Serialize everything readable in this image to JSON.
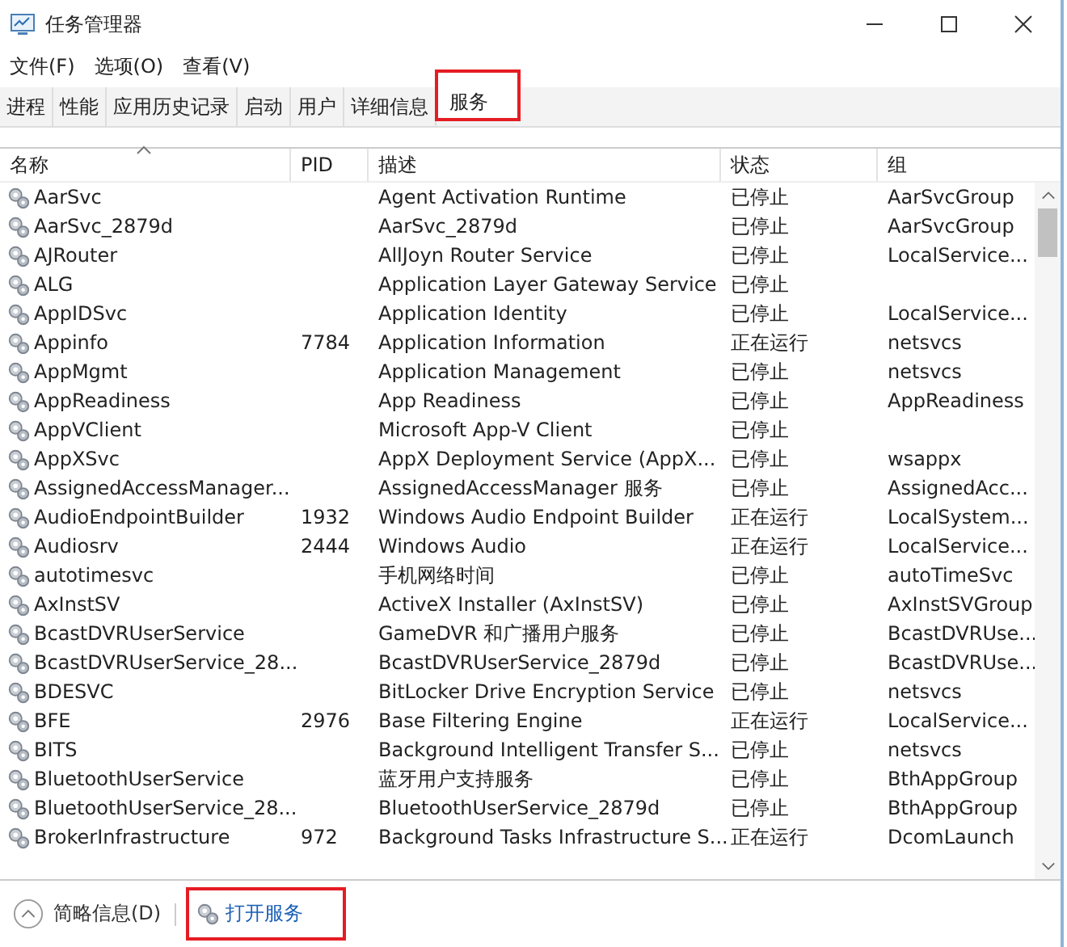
{
  "window": {
    "title": "任务管理器"
  },
  "menu": [
    "文件(F)",
    "选项(O)",
    "查看(V)"
  ],
  "tabs": [
    {
      "label": "进程",
      "selected": false,
      "highlighted": false
    },
    {
      "label": "性能",
      "selected": false,
      "highlighted": false
    },
    {
      "label": "应用历史记录",
      "selected": false,
      "highlighted": false
    },
    {
      "label": "启动",
      "selected": false,
      "highlighted": false
    },
    {
      "label": "用户",
      "selected": false,
      "highlighted": false
    },
    {
      "label": "详细信息",
      "selected": false,
      "highlighted": false
    },
    {
      "label": "服务",
      "selected": true,
      "highlighted": true
    }
  ],
  "table": {
    "columns": [
      "名称",
      "PID",
      "描述",
      "状态",
      "组"
    ],
    "rows": [
      [
        "AarSvc",
        "",
        "Agent Activation Runtime",
        "已停止",
        "AarSvcGroup"
      ],
      [
        "AarSvc_2879d",
        "",
        "AarSvc_2879d",
        "已停止",
        "AarSvcGroup"
      ],
      [
        "AJRouter",
        "",
        "AllJoyn Router Service",
        "已停止",
        "LocalService..."
      ],
      [
        "ALG",
        "",
        "Application Layer Gateway Service",
        "已停止",
        ""
      ],
      [
        "AppIDSvc",
        "",
        "Application Identity",
        "已停止",
        "LocalService..."
      ],
      [
        "Appinfo",
        "7784",
        "Application Information",
        "正在运行",
        "netsvcs"
      ],
      [
        "AppMgmt",
        "",
        "Application Management",
        "已停止",
        "netsvcs"
      ],
      [
        "AppReadiness",
        "",
        "App Readiness",
        "已停止",
        "AppReadiness"
      ],
      [
        "AppVClient",
        "",
        "Microsoft App-V Client",
        "已停止",
        ""
      ],
      [
        "AppXSvc",
        "",
        "AppX Deployment Service (AppX...",
        "已停止",
        "wsappx"
      ],
      [
        "AssignedAccessManager...",
        "",
        "AssignedAccessManager 服务",
        "已停止",
        "AssignedAcc..."
      ],
      [
        "AudioEndpointBuilder",
        "1932",
        "Windows Audio Endpoint Builder",
        "正在运行",
        "LocalSystem..."
      ],
      [
        "Audiosrv",
        "2444",
        "Windows Audio",
        "正在运行",
        "LocalService..."
      ],
      [
        "autotimesvc",
        "",
        "手机网络时间",
        "已停止",
        "autoTimeSvc"
      ],
      [
        "AxInstSV",
        "",
        "ActiveX Installer (AxInstSV)",
        "已停止",
        "AxInstSVGroup"
      ],
      [
        "BcastDVRUserService",
        "",
        "GameDVR 和广播用户服务",
        "已停止",
        "BcastDVRUse..."
      ],
      [
        "BcastDVRUserService_28...",
        "",
        "BcastDVRUserService_2879d",
        "已停止",
        "BcastDVRUse..."
      ],
      [
        "BDESVC",
        "",
        "BitLocker Drive Encryption Service",
        "已停止",
        "netsvcs"
      ],
      [
        "BFE",
        "2976",
        "Base Filtering Engine",
        "正在运行",
        "LocalService..."
      ],
      [
        "BITS",
        "",
        "Background Intelligent Transfer S...",
        "已停止",
        "netsvcs"
      ],
      [
        "BluetoothUserService",
        "",
        "蓝牙用户支持服务",
        "已停止",
        "BthAppGroup"
      ],
      [
        "BluetoothUserService_28...",
        "",
        "BluetoothUserService_2879d",
        "已停止",
        "BthAppGroup"
      ],
      [
        "BrokerInfrastructure",
        "972",
        "Background Tasks Infrastructure S...",
        "正在运行",
        "DcomLaunch"
      ]
    ]
  },
  "footer": {
    "details": "简略信息(D)",
    "link": {
      "label": "打开服务",
      "highlighted": true
    }
  }
}
